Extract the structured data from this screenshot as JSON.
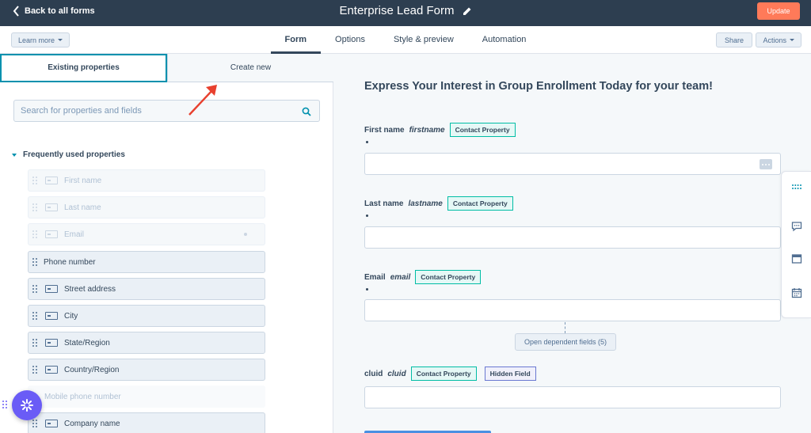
{
  "topbar": {
    "back_label": "Back to all forms",
    "form_title": "Enterprise Lead Form",
    "update_label": "Update"
  },
  "navbar": {
    "learn_more": "Learn more",
    "tabs": [
      "Form",
      "Options",
      "Style & preview",
      "Automation"
    ],
    "active_tab": "Form",
    "share": "Share",
    "actions": "Actions"
  },
  "left_panel": {
    "tabs": [
      "Existing properties",
      "Create new"
    ],
    "search_placeholder": "Search for properties and fields",
    "section_title": "Frequently used properties",
    "properties": [
      {
        "label": "First name",
        "state": "disabled"
      },
      {
        "label": "Last name",
        "state": "disabled"
      },
      {
        "label": "Email",
        "state": "disabled"
      },
      {
        "label": "Phone number",
        "state": "enabled"
      },
      {
        "label": "Street address",
        "state": "enabled"
      },
      {
        "label": "City",
        "state": "enabled"
      },
      {
        "label": "State/Region",
        "state": "enabled"
      },
      {
        "label": "Country/Region",
        "state": "enabled"
      },
      {
        "label": "Mobile phone number",
        "state": "disabled"
      },
      {
        "label": "Company name",
        "state": "enabled"
      }
    ]
  },
  "canvas": {
    "heading": "Express Your Interest in Group Enrollment Today for your team!",
    "fields": [
      {
        "label": "First name",
        "internal": "firstname",
        "badge": "Contact Property"
      },
      {
        "label": "Last name",
        "internal": "lastname",
        "badge": "Contact Property"
      },
      {
        "label": "Email",
        "internal": "email",
        "badge": "Contact Property"
      },
      {
        "label": "cluid",
        "internal": "cluid",
        "badge": "Contact Property",
        "badge2": "Hidden Field"
      }
    ],
    "dependent_fields_button": "Open dependent fields (5)"
  },
  "colors": {
    "topbar": "#2d3e50",
    "accent": "#0091ae",
    "update": "#ff7a59",
    "badge_border": "#00bda5",
    "annotation_arrow": "#e8402e",
    "fab": "#6a5cf6"
  }
}
